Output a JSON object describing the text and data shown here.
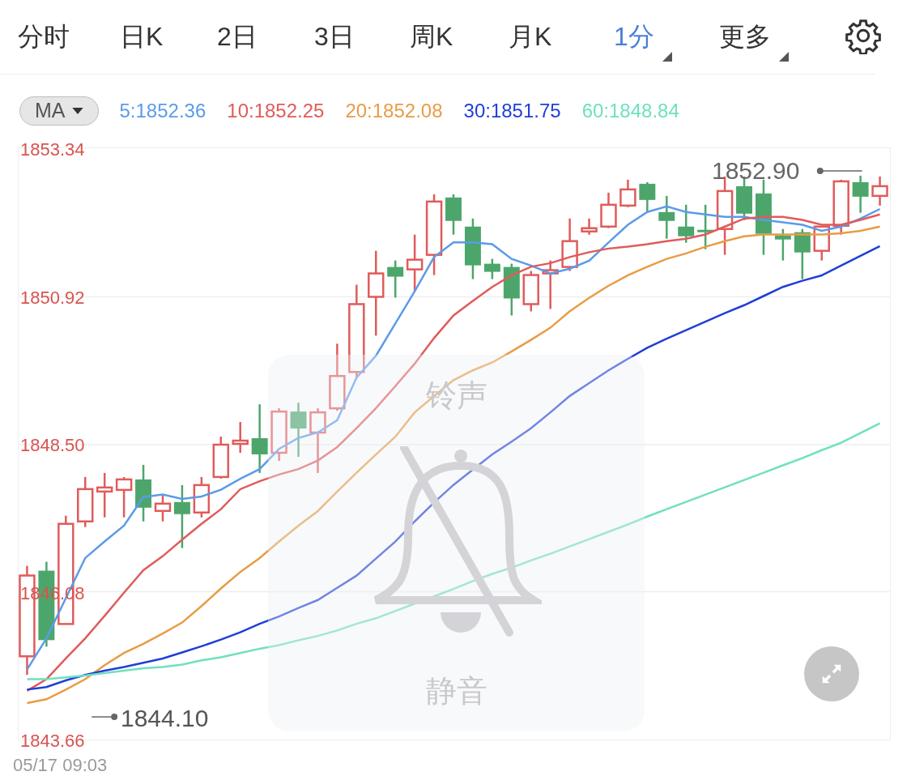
{
  "tabs": [
    {
      "label": "分时",
      "selected": false,
      "dropdown": false
    },
    {
      "label": "日K",
      "selected": false,
      "dropdown": false
    },
    {
      "label": "2日",
      "selected": false,
      "dropdown": false
    },
    {
      "label": "3日",
      "selected": false,
      "dropdown": false
    },
    {
      "label": "周K",
      "selected": false,
      "dropdown": false
    },
    {
      "label": "月K",
      "selected": false,
      "dropdown": false
    },
    {
      "label": "1分",
      "selected": true,
      "dropdown": true
    },
    {
      "label": "更多",
      "selected": false,
      "dropdown": true
    }
  ],
  "indicator": {
    "label": "MA"
  },
  "chart": {
    "max_marker": "1852.90",
    "min_marker": "1844.10",
    "chart_data": {
      "type": "line",
      "grid": true,
      "ylim": [
        1843.66,
        1853.34
      ],
      "yticks": [
        {
          "value": 1853.34,
          "label": "1853.34"
        },
        {
          "value": 1850.92,
          "label": "1850.92"
        },
        {
          "value": 1848.5,
          "label": "1848.50"
        },
        {
          "value": 1846.08,
          "label": "1846.08"
        },
        {
          "value": 1843.66,
          "label": "1843.66"
        }
      ],
      "series": [
        {
          "name": "5:1852.36",
          "color": "#5b9be8",
          "values": [
            1844.81,
            1845.32,
            1845.98,
            1846.64,
            1846.91,
            1847.17,
            1847.64,
            1847.68,
            1847.61,
            1847.65,
            1847.76,
            1847.94,
            1848.1,
            1848.43,
            1848.61,
            1848.7,
            1848.9,
            1849.6,
            1849.96,
            1850.49,
            1851.02,
            1851.58,
            1851.82,
            1851.82,
            1851.79,
            1851.55,
            1851.44,
            1851.31,
            1851.39,
            1851.52,
            1851.82,
            1852.11,
            1852.32,
            1852.41,
            1852.32,
            1852.28,
            1852.24,
            1852.24,
            1852.19,
            1852.15,
            1852.11,
            1852.01,
            1852.08,
            1852.21,
            1852.37
          ]
        },
        {
          "name": "10:1852.25",
          "color": "#e05b5b",
          "values": [
            1844.46,
            1844.65,
            1844.99,
            1845.32,
            1845.69,
            1846.07,
            1846.44,
            1846.67,
            1846.94,
            1847.2,
            1847.44,
            1847.77,
            1847.9,
            1848.01,
            1848.1,
            1848.24,
            1848.46,
            1848.77,
            1849.1,
            1849.46,
            1849.83,
            1850.25,
            1850.62,
            1850.86,
            1851.09,
            1851.28,
            1851.42,
            1851.48,
            1851.58,
            1851.66,
            1851.72,
            1851.75,
            1851.79,
            1851.84,
            1851.88,
            1851.95,
            1852.08,
            1852.21,
            1852.24,
            1852.24,
            1852.19,
            1852.11,
            1852.11,
            1852.19,
            1852.28
          ]
        },
        {
          "name": "20:1852.08",
          "color": "#e89c45",
          "values": [
            1844.26,
            1844.32,
            1844.48,
            1844.65,
            1844.88,
            1845.08,
            1845.23,
            1845.4,
            1845.58,
            1845.85,
            1846.14,
            1846.41,
            1846.64,
            1846.91,
            1847.17,
            1847.41,
            1847.73,
            1848.04,
            1848.34,
            1848.63,
            1849.03,
            1849.3,
            1849.56,
            1849.72,
            1849.85,
            1850.03,
            1850.22,
            1850.42,
            1850.69,
            1850.91,
            1851.11,
            1851.28,
            1851.42,
            1851.55,
            1851.64,
            1851.75,
            1851.84,
            1851.92,
            1851.95,
            1851.95,
            1851.95,
            1851.95,
            1851.97,
            1852.01,
            1852.08
          ]
        },
        {
          "name": "30:1851.75",
          "color": "#1f3fd6",
          "values": [
            1844.48,
            1844.52,
            1844.63,
            1844.72,
            1844.79,
            1844.85,
            1844.92,
            1844.99,
            1845.09,
            1845.19,
            1845.3,
            1845.42,
            1845.56,
            1845.68,
            1845.82,
            1845.95,
            1846.15,
            1846.35,
            1846.63,
            1846.91,
            1847.24,
            1847.55,
            1847.84,
            1848.09,
            1848.34,
            1848.55,
            1848.77,
            1849.03,
            1849.3,
            1849.51,
            1849.72,
            1849.91,
            1850.09,
            1850.24,
            1850.38,
            1850.52,
            1850.66,
            1850.79,
            1850.94,
            1851.09,
            1851.19,
            1851.28,
            1851.44,
            1851.6,
            1851.76
          ]
        },
        {
          "name": "60:1848.84",
          "color": "#6fe0c0",
          "values": [
            1844.65,
            1844.65,
            1844.68,
            1844.71,
            1844.75,
            1844.79,
            1844.83,
            1844.85,
            1844.89,
            1844.96,
            1845.01,
            1845.08,
            1845.15,
            1845.21,
            1845.29,
            1845.36,
            1845.45,
            1845.56,
            1845.65,
            1845.77,
            1845.89,
            1846.01,
            1846.13,
            1846.26,
            1846.38,
            1846.48,
            1846.6,
            1846.71,
            1846.83,
            1846.95,
            1847.07,
            1847.19,
            1847.32,
            1847.44,
            1847.56,
            1847.68,
            1847.8,
            1847.92,
            1848.04,
            1848.16,
            1848.28,
            1848.41,
            1848.53,
            1848.69,
            1848.85
          ]
        }
      ]
    }
  },
  "silent_hud": {
    "top_label": "铃声",
    "bottom_label": "静音"
  },
  "timestamp": "05/17 09:03"
}
